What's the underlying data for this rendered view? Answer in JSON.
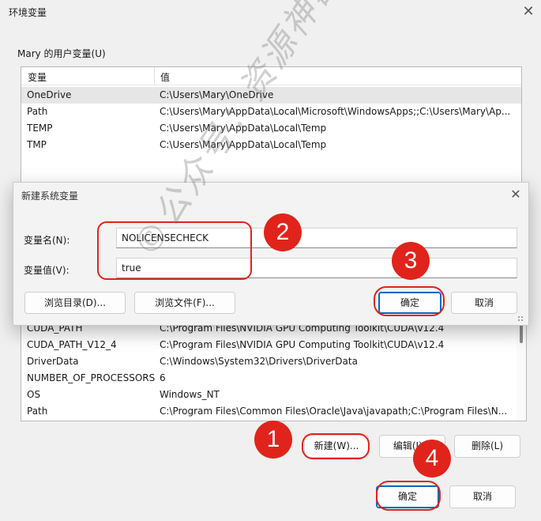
{
  "window": {
    "title": "环境变量",
    "close": "✕"
  },
  "user_vars": {
    "group_label": "Mary 的用户变量(U)",
    "col_name": "变量",
    "col_value": "值",
    "rows": [
      {
        "name": "OneDrive",
        "value": "C:\\Users\\Mary\\OneDrive"
      },
      {
        "name": "Path",
        "value": "C:\\Users\\Mary\\AppData\\Local\\Microsoft\\WindowsApps;;C:\\Users\\Mary\\Ap..."
      },
      {
        "name": "TEMP",
        "value": "C:\\Users\\Mary\\AppData\\Local\\Temp"
      },
      {
        "name": "TMP",
        "value": "C:\\Users\\Mary\\AppData\\Local\\Temp"
      }
    ]
  },
  "system_vars": {
    "rows": [
      {
        "name": "CUDA_PATH",
        "value": "C:\\Program Files\\NVIDIA GPU Computing Toolkit\\CUDA\\v12.4"
      },
      {
        "name": "CUDA_PATH_V12_4",
        "value": "C:\\Program Files\\NVIDIA GPU Computing Toolkit\\CUDA\\v12.4"
      },
      {
        "name": "DriverData",
        "value": "C:\\Windows\\System32\\Drivers\\DriverData"
      },
      {
        "name": "NUMBER_OF_PROCESSORS",
        "value": "6"
      },
      {
        "name": "OS",
        "value": "Windows_NT"
      },
      {
        "name": "Path",
        "value": "C:\\Program Files\\Common Files\\Oracle\\Java\\javapath;C:\\Program Files\\N..."
      }
    ],
    "buttons": {
      "new": "新建(W)...",
      "edit": "编辑(I)...",
      "delete": "删除(L)"
    }
  },
  "footer": {
    "ok": "确定",
    "cancel": "取消"
  },
  "dialog": {
    "title": "新建系统变量",
    "close": "✕",
    "name_label": "变量名(N):",
    "name_value": "NOLICENSECHECK",
    "value_label": "变量值(V):",
    "value_value": "true",
    "browse_dir": "浏览目录(D)...",
    "browse_file": "浏览文件(F)...",
    "ok": "确定",
    "cancel": "取消"
  },
  "annotations": {
    "step1": "1",
    "step2": "2",
    "step3": "3",
    "step4": "4",
    "color": "#e0241b"
  },
  "watermark": "©公众号：资源神器"
}
